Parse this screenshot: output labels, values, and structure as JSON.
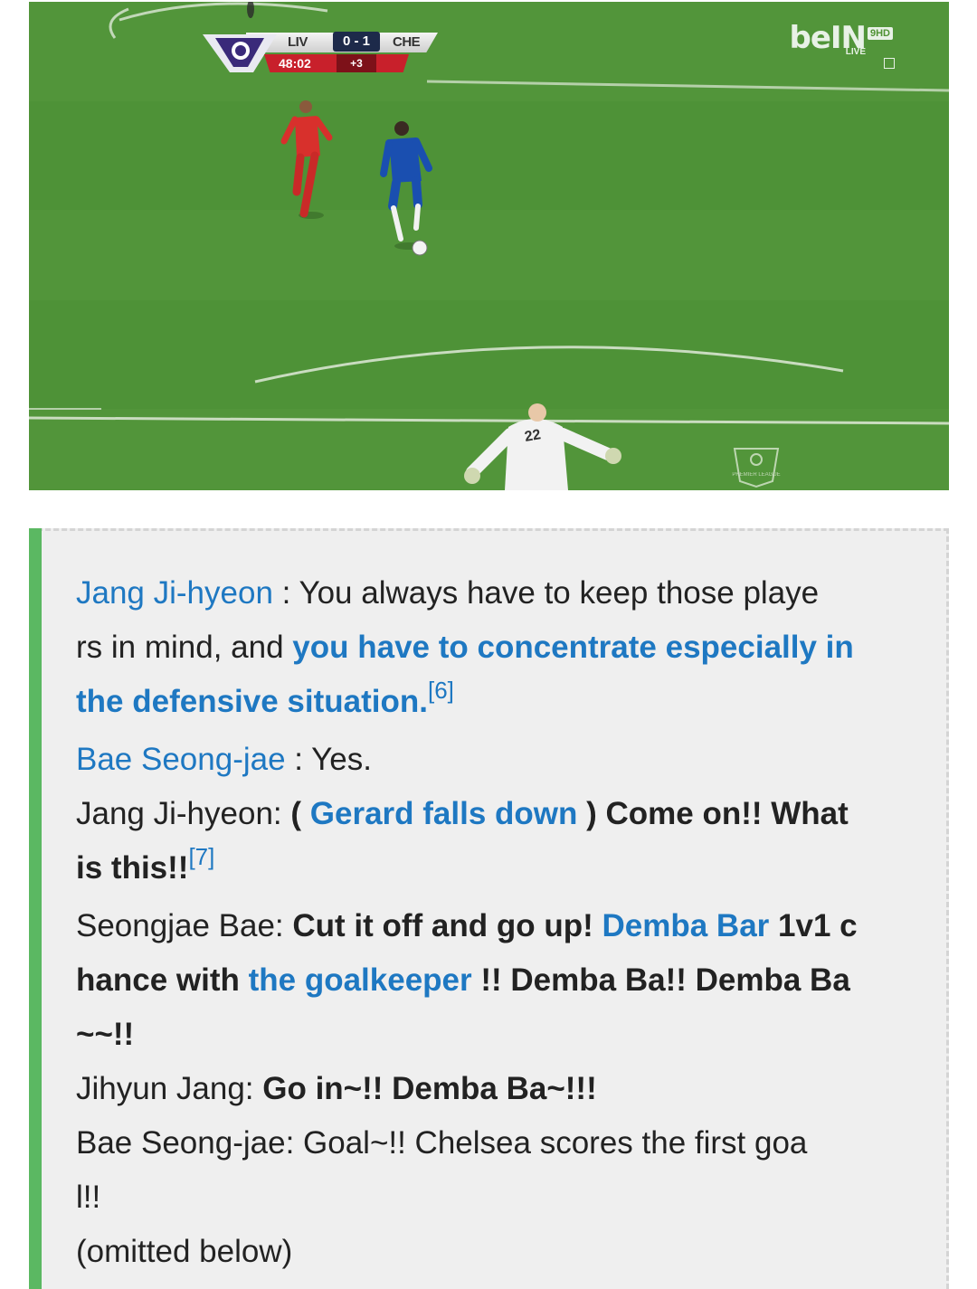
{
  "broadcast": {
    "scoreboard": {
      "home_team": "LIV",
      "score": "0 - 1",
      "away_team": "CHE",
      "clock": "48:02",
      "added_time": "+3"
    },
    "channel": {
      "logo_text": "beIN",
      "hd_label": "9HD",
      "live_label": "LIVE"
    },
    "player_number": "22",
    "league_badge_text": "PREMIER LEAGUE",
    "colors": {
      "pitch": "#4f9234",
      "home_kit": "#d8302c",
      "away_kit": "#1a4fb0",
      "score_bg": "#1d2a4a",
      "clock_bg": "#c8202b"
    }
  },
  "transcript": {
    "accent_color": "#1e78c2",
    "bar_color": "#5bb862",
    "lines": {
      "l1_speaker": "Jang Ji-hyeon",
      "l1_text": " : You always have to keep those playe",
      "l2_text": "rs in mind, and ",
      "l2_link": "you have to concentrate especially in",
      "l3_link": "the defensive situation.",
      "l3_ref": "[6]",
      "l4_speaker": "Bae Seong-jae",
      "l4_text": " : Yes.",
      "l5_prefix": "Jang Ji-hyeon: ",
      "l5_paren_open": "( ",
      "l5_link": "Gerard falls down",
      "l5_paren_close": " ) ",
      "l5_bold": "Come on!! What",
      "l6_bold": "is this!!",
      "l6_ref": "[7]",
      "l7_prefix": "Seongjae Bae: ",
      "l7_bold": "Cut it off and go up! ",
      "l7_link": "Demba Bar",
      "l7_bold_end": " 1v1 c",
      "l8_bold": "hance with ",
      "l8_link": "the goalkeeper",
      "l8_bold_end": " !! Demba Ba!! Demba Ba",
      "l9_bold": "~~!!",
      "l10_prefix": "Jihyun Jang: ",
      "l10_bold": "Go in~!! Demba Ba~!!!",
      "l11_text": "Bae Seong-jae: Goal~!! Chelsea scores the first goa",
      "l12_text": "l!!",
      "l13_text": "(omitted below)"
    }
  }
}
